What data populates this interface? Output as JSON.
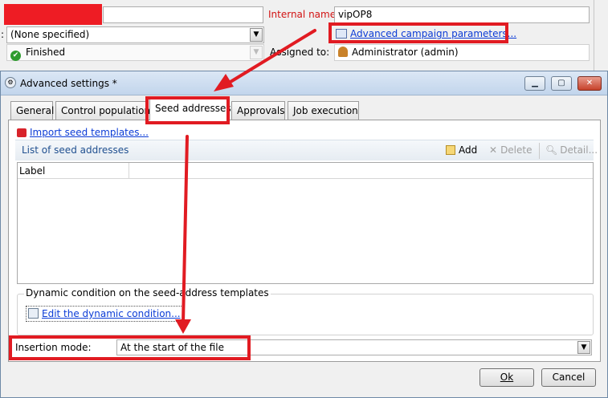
{
  "background_form": {
    "internal_name_label": "Internal name:",
    "internal_name_value": "vipOP8",
    "left_combo_prefix": ":",
    "left_combo_value": "(None specified)",
    "status_value": "Finished",
    "advanced_params_link": "Advanced campaign parameters...",
    "assigned_to_label": "Assigned to:",
    "assigned_to_value": "Administrator (admin)"
  },
  "dialog": {
    "title": "Advanced settings *",
    "tabs": [
      {
        "label": "General"
      },
      {
        "label": "Control population"
      },
      {
        "label": "Seed addresses"
      },
      {
        "label": "Approvals"
      },
      {
        "label": "Job execution"
      }
    ],
    "import_link": "Import seed templates...",
    "list_title": "List of seed addresses",
    "toolbar": {
      "add_label": "Add",
      "delete_label": "Delete",
      "detail_label": "Detail..."
    },
    "grid": {
      "columns": [
        "Label"
      ]
    },
    "dynamic_group": {
      "title": "Dynamic condition on the seed-address templates",
      "edit_link": "Edit the dynamic condition..."
    },
    "insertion_mode": {
      "label": "Insertion mode:",
      "value": "At the start of the file"
    },
    "buttons": {
      "ok_label": "Ok",
      "cancel_label": "Cancel"
    }
  },
  "colors": {
    "annotation_red": "#e11b22",
    "link_blue": "#0b3bd6",
    "label_red": "#d21313"
  },
  "icons": [
    "check-icon",
    "params-icon",
    "user-icon",
    "settings-icon",
    "minimize-icon",
    "maximize-icon",
    "close-icon",
    "import-icon",
    "add-icon",
    "delete-icon",
    "detail-icon",
    "condition-icon",
    "chevron-down-icon"
  ]
}
